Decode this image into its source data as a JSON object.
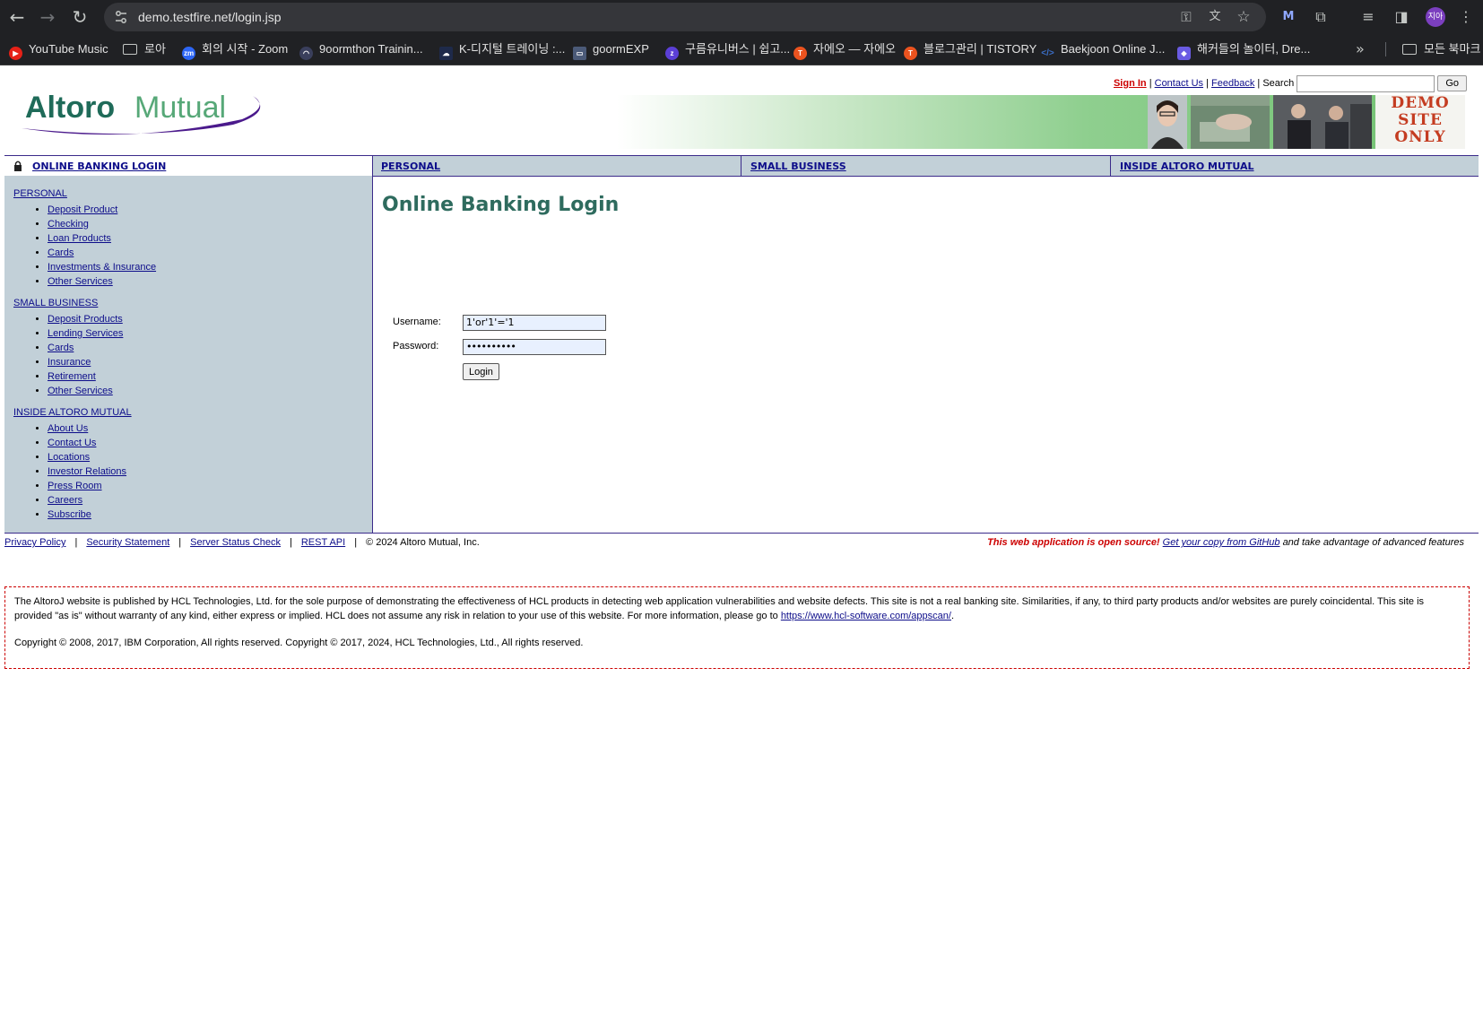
{
  "browser": {
    "url": "demo.testfire.net/login.jsp",
    "nav_icons": [
      "back-arrow-icon",
      "forward-arrow-icon",
      "reload-icon"
    ],
    "profile_label": "지아",
    "bookmarks": [
      {
        "label": "YouTube Music",
        "icon": "youtube-music-icon",
        "color": "#e62117"
      },
      {
        "label": "로아",
        "icon": "folder-icon",
        "color": ""
      },
      {
        "label": "회의 시작 - Zoom",
        "icon": "zoom-icon",
        "color": "#2d66f5"
      },
      {
        "label": "9oormthon Trainin...",
        "icon": "goorm-icon",
        "color": "#3a3f5c"
      },
      {
        "label": "K-디지털 트레이닝 :...",
        "icon": "cloud-icon",
        "color": "#1e2a4a"
      },
      {
        "label": "goormEXP",
        "icon": "goormexp-icon",
        "color": "#4b5a78"
      },
      {
        "label": "구름유니버스 | 쉽고...",
        "icon": "universe-icon",
        "color": "#5b3fd6"
      },
      {
        "label": "자에오 — 자에오",
        "icon": "tistory-icon",
        "color": "#eb531f"
      },
      {
        "label": "블로그관리 | TISTORY",
        "icon": "tistory-icon",
        "color": "#eb531f"
      },
      {
        "label": "Baekjoon Online J...",
        "icon": "code-icon",
        "color": "#3b6fc9"
      },
      {
        "label": "해커들의 놀이터, Dre...",
        "icon": "shield-icon",
        "color": "#6a5be3"
      }
    ],
    "all_bookmarks": "모든 북마크"
  },
  "header": {
    "logo_text_altoro": "Altoro",
    "logo_text_mutual": "Mutual",
    "sign_in": "Sign In",
    "contact_us": "Contact Us",
    "feedback": "Feedback",
    "search_label": "Search",
    "go_button": "Go",
    "demo_stamp": [
      "DEMO",
      "SITE",
      "ONLY"
    ]
  },
  "nav": {
    "login": "ONLINE BANKING LOGIN",
    "personal": "PERSONAL",
    "small_business": "SMALL BUSINESS",
    "inside": "INSIDE ALTORO MUTUAL"
  },
  "sidebar": {
    "personal": {
      "title": "PERSONAL",
      "items": [
        "Deposit Product",
        "Checking",
        "Loan Products",
        "Cards",
        "Investments & Insurance",
        "Other Services"
      ]
    },
    "small_business": {
      "title": "SMALL BUSINESS",
      "items": [
        "Deposit Products",
        "Lending Services",
        "Cards",
        "Insurance",
        "Retirement",
        "Other Services"
      ]
    },
    "inside": {
      "title": "INSIDE ALTORO MUTUAL",
      "items": [
        "About Us",
        "Contact Us",
        "Locations",
        "Investor Relations",
        "Press Room",
        "Careers",
        "Subscribe"
      ]
    }
  },
  "main": {
    "title": "Online Banking Login",
    "username_label": "Username:",
    "username_value": "1'or'1'='1",
    "password_label": "Password:",
    "password_value": "••••••••••",
    "login_button": "Login"
  },
  "footer": {
    "links": [
      "Privacy Policy",
      "Security Statement",
      "Server Status Check",
      "REST API"
    ],
    "copyright": "© 2024 Altoro Mutual, Inc.",
    "open_source": "This web application is open source!",
    "github_link": "Get your copy from GitHub",
    "open_source_tail": "and take advantage of advanced features"
  },
  "disclaimer": {
    "text": "The AltoroJ website is published by HCL Technologies, Ltd. for the sole purpose of demonstrating the effectiveness of HCL products in detecting web application vulnerabilities and website defects. This site is not a real banking site. Similarities, if any, to third party products and/or websites are purely coincidental. This site is provided \"as is\" without warranty of any kind, either express or implied. HCL does not assume any risk in relation to your use of this website. For more information, please go to",
    "link": "https://www.hcl-software.com/appscan/",
    "end": ".",
    "copyright": "Copyright © 2008, 2017, IBM Corporation, All rights reserved. Copyright © 2017, 2024, HCL Technologies, Ltd., All rights reserved."
  },
  "colors": {
    "link": "#0d0d8a",
    "sidebar_bg": "#c2d0d8",
    "title_green": "#2e6b5e",
    "alert_red": "#cc0000",
    "nav_border": "#3b2b8a"
  }
}
